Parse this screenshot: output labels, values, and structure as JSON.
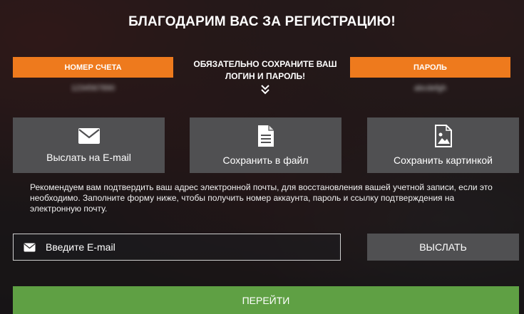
{
  "page": {
    "title": "БЛАГОДАРИМ ВАС ЗА РЕГИСТРАЦИЮ!"
  },
  "credentials": {
    "account_label": "НОМЕР СЧЕТА",
    "account_value": "1234567890",
    "notice": "ОБЯЗАТЕЛЬНО СОХРАНИТЕ ВАШ ЛОГИН И ПАРОЛЬ!",
    "password_label": "ПАРОЛЬ",
    "password_value": "abcdefgh"
  },
  "actions": [
    {
      "label": "Выслать на E-mail",
      "icon": "envelope-icon"
    },
    {
      "label": "Сохранить в файл",
      "icon": "document-icon"
    },
    {
      "label": "Сохранить картинкой",
      "icon": "image-file-icon"
    }
  ],
  "info_text": "Рекомендуем вам подтвердить ваш адрес электронной почты, для восстановления вашей учетной записи, если это необходимо. Заполните форму ниже, чтобы получить номер аккаунта, пароль и ссылку подтверждения на электронную почту.",
  "email_form": {
    "placeholder": "Введите E-mail",
    "send_label": "ВЫСЛАТЬ"
  },
  "go_label": "ПЕРЕЙТИ",
  "colors": {
    "orange": "#ee7a1d",
    "tile_gray": "#505052",
    "green": "#5fa044"
  }
}
